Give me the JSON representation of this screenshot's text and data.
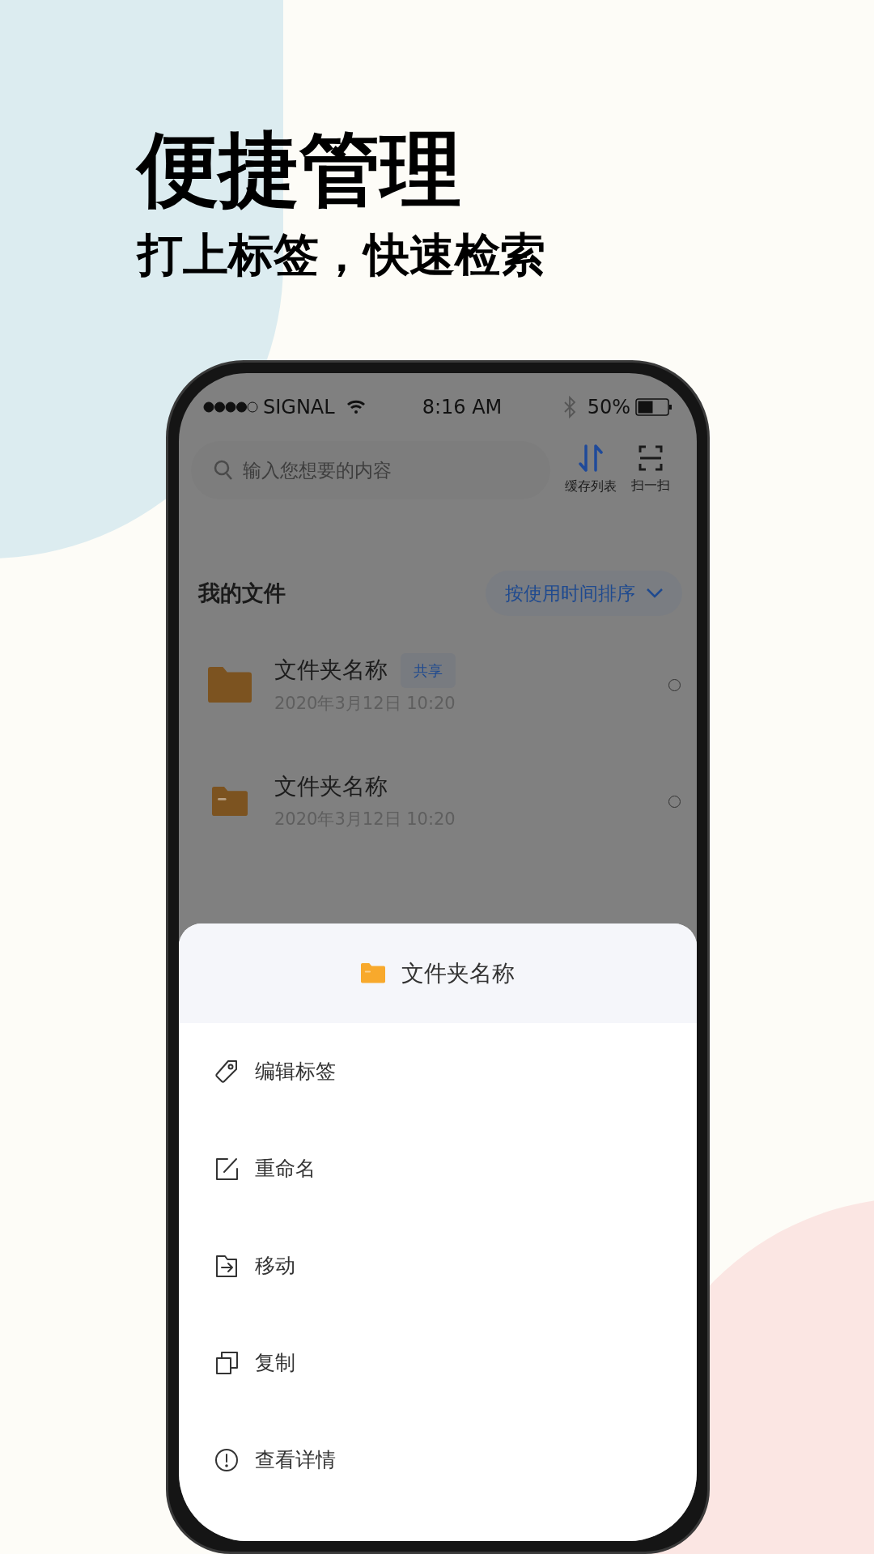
{
  "headline": "便捷管理",
  "subheadline": "打上标签，快速检索",
  "status_bar": {
    "carrier": "SIGNAL",
    "time": "8:16 AM",
    "battery": "50%"
  },
  "search": {
    "placeholder": "输入您想要的内容"
  },
  "toolbar": [
    {
      "label": "缓存列表",
      "kind": "transfer"
    },
    {
      "label": "扫一扫",
      "kind": "scan"
    }
  ],
  "section": {
    "title": "我的文件",
    "sort": "按使用时间排序"
  },
  "files": [
    {
      "name": "文件夹名称",
      "tag": "共享",
      "date": "2020年3月12日 10:20",
      "kind": "folder",
      "selected": false
    },
    {
      "name": "文件夹名称",
      "date": "2020年3月12日 10:20",
      "kind": "folder-dash",
      "selected": false
    }
  ],
  "sheet": {
    "title": "文件夹名称",
    "actions": [
      {
        "label": "编辑标签",
        "kind": "tag"
      },
      {
        "label": "重命名",
        "kind": "rename"
      },
      {
        "label": "移动",
        "kind": "move"
      },
      {
        "label": "复制",
        "kind": "copy"
      },
      {
        "label": "查看详情",
        "kind": "info"
      }
    ]
  }
}
